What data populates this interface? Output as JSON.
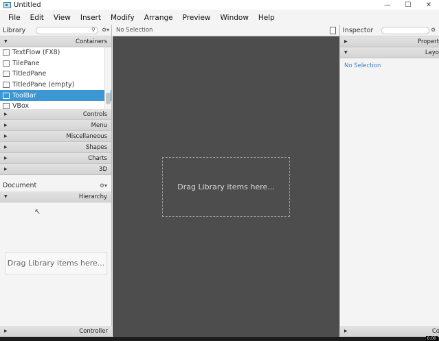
{
  "window": {
    "title": "Untitled",
    "minimize_glyph": "—",
    "maximize_glyph": "☐",
    "close_glyph": "✕"
  },
  "menu": [
    "File",
    "Edit",
    "View",
    "Insert",
    "Modify",
    "Arrange",
    "Preview",
    "Window",
    "Help"
  ],
  "library": {
    "title": "Library",
    "search_placeholder": "",
    "containers_label": "Containers",
    "items": [
      {
        "label": "TextFlow  (FX8)",
        "selected": false
      },
      {
        "label": "TilePane",
        "selected": false
      },
      {
        "label": "TitledPane",
        "selected": false
      },
      {
        "label": "TitledPane  (empty)",
        "selected": false
      },
      {
        "label": "ToolBar",
        "selected": true
      },
      {
        "label": "VBox",
        "selected": false
      }
    ],
    "sections": [
      "Controls",
      "Menu",
      "Miscellaneous",
      "Shapes",
      "Charts",
      "3D"
    ]
  },
  "document": {
    "title": "Document",
    "hierarchy_label": "Hierarchy",
    "drop_hint": "Drag Library items here...",
    "controller_label": "Controller"
  },
  "center": {
    "selection_text": "No Selection",
    "drop_hint": "Drag Library items here..."
  },
  "inspector": {
    "title": "Inspector",
    "properties_label": "Propert",
    "layout_label": "Layo",
    "no_selection": "No Selection",
    "code_label": "Co"
  },
  "taskbar": {
    "clock": "0:00"
  }
}
